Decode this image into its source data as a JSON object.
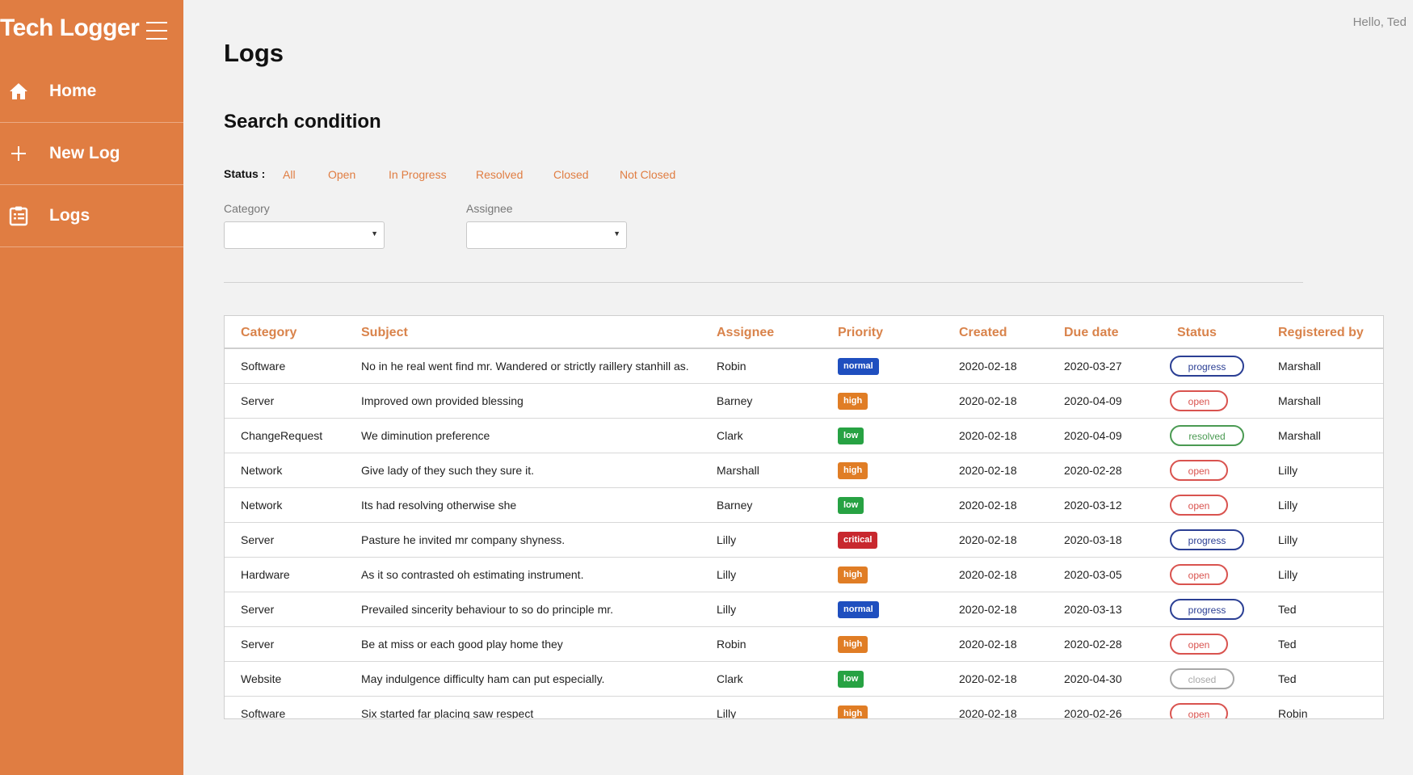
{
  "app": {
    "title": "Tech Logger",
    "greeting": "Hello, Ted"
  },
  "sidebar": {
    "items": [
      {
        "label": "Home",
        "icon": "home-icon"
      },
      {
        "label": "New Log",
        "icon": "plus-icon"
      },
      {
        "label": "Logs",
        "icon": "clipboard-icon"
      }
    ]
  },
  "page": {
    "title": "Logs",
    "search_title": "Search condition"
  },
  "filters": {
    "status_label": "Status :",
    "status_options": [
      "All",
      "Open",
      "In Progress",
      "Resolved",
      "Closed",
      "Not Closed"
    ],
    "category_label": "Category",
    "category_value": "",
    "assignee_label": "Assignee",
    "assignee_value": ""
  },
  "table": {
    "columns": [
      "Category",
      "Subject",
      "Assignee",
      "Priority",
      "Created",
      "Due date",
      "Status",
      "Registered by"
    ],
    "rows": [
      {
        "category": "Software",
        "subject": "No in he real went find mr. Wandered or strictly raillery stanhill as.",
        "assignee": "Robin",
        "priority": "normal",
        "created": "2020-02-18",
        "due": "2020-03-27",
        "status": "progress",
        "registered_by": "Marshall"
      },
      {
        "category": "Server",
        "subject": "Improved own provided blessing",
        "assignee": "Barney",
        "priority": "high",
        "created": "2020-02-18",
        "due": "2020-04-09",
        "status": "open",
        "registered_by": "Marshall"
      },
      {
        "category": "ChangeRequest",
        "subject": "We diminution preference",
        "assignee": "Clark",
        "priority": "low",
        "created": "2020-02-18",
        "due": "2020-04-09",
        "status": "resolved",
        "registered_by": "Marshall"
      },
      {
        "category": "Network",
        "subject": "Give lady of they such they sure it.",
        "assignee": "Marshall",
        "priority": "high",
        "created": "2020-02-18",
        "due": "2020-02-28",
        "status": "open",
        "registered_by": "Lilly"
      },
      {
        "category": "Network",
        "subject": "Its had resolving otherwise she",
        "assignee": "Barney",
        "priority": "low",
        "created": "2020-02-18",
        "due": "2020-03-12",
        "status": "open",
        "registered_by": "Lilly"
      },
      {
        "category": "Server",
        "subject": "Pasture he invited mr company shyness.",
        "assignee": "Lilly",
        "priority": "critical",
        "created": "2020-02-18",
        "due": "2020-03-18",
        "status": "progress",
        "registered_by": "Lilly"
      },
      {
        "category": "Hardware",
        "subject": "As it so contrasted oh estimating instrument.",
        "assignee": "Lilly",
        "priority": "high",
        "created": "2020-02-18",
        "due": "2020-03-05",
        "status": "open",
        "registered_by": "Lilly"
      },
      {
        "category": "Server",
        "subject": "Prevailed sincerity behaviour to so do principle mr.",
        "assignee": "Lilly",
        "priority": "normal",
        "created": "2020-02-18",
        "due": "2020-03-13",
        "status": "progress",
        "registered_by": "Ted"
      },
      {
        "category": "Server",
        "subject": "Be at miss or each good play home they",
        "assignee": "Robin",
        "priority": "high",
        "created": "2020-02-18",
        "due": "2020-02-28",
        "status": "open",
        "registered_by": "Ted"
      },
      {
        "category": "Website",
        "subject": "May indulgence difficulty ham can put especially.",
        "assignee": "Clark",
        "priority": "low",
        "created": "2020-02-18",
        "due": "2020-04-30",
        "status": "closed",
        "registered_by": "Ted"
      },
      {
        "category": "Software",
        "subject": "Six started far placing saw respect",
        "assignee": "Lilly",
        "priority": "high",
        "created": "2020-02-18",
        "due": "2020-02-26",
        "status": "open",
        "registered_by": "Robin"
      }
    ]
  },
  "colors": {
    "accent": "#e07d42",
    "priority": {
      "normal": "#1f4fbf",
      "high": "#e07d25",
      "low": "#27a243",
      "critical": "#c8282e"
    },
    "status": {
      "progress": "#2b3f94",
      "open": "#d9534f",
      "resolved": "#4a9a52",
      "closed": "#a8a8a8"
    }
  }
}
